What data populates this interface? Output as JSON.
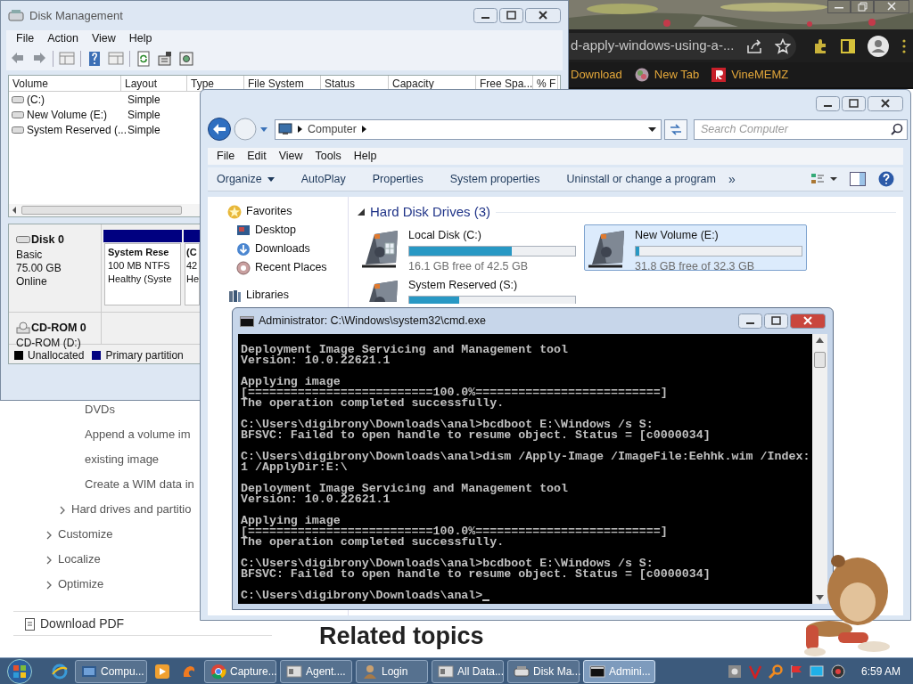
{
  "browser": {
    "url": "d-apply-windows-using-a-...",
    "bookmarks": [
      {
        "label": "Download",
        "kind": "none"
      },
      {
        "label": "New Tab",
        "kind": "globe"
      },
      {
        "label": "VineMEMZ",
        "kind": "letter"
      }
    ],
    "page": {
      "nav": [
        {
          "children": [
            {
              "children": [
                {
                  "lines": [
                    "DVDs"
                  ]
                },
                {
                  "lines": [
                    "Append a volume im",
                    "existing image"
                  ]
                },
                {
                  "lines": [
                    "Create a WIM data in"
                  ]
                }
              ]
            },
            {
              "lines": [
                "Hard drives and partitio"
              ],
              "expanded": false
            }
          ]
        },
        {
          "lines": [
            "Customize"
          ],
          "expanded": false
        },
        {
          "lines": [
            "Localize"
          ],
          "expanded": false
        },
        {
          "lines": [
            "Optimize"
          ],
          "expanded": false
        }
      ],
      "download": "Download PDF",
      "heading": "Related topics"
    }
  },
  "disk_management": {
    "title": "Disk Management",
    "menu": [
      "File",
      "Action",
      "View",
      "Help"
    ],
    "columns": [
      "Volume",
      "Layout",
      "Type",
      "File System",
      "Status",
      "Capacity",
      "Free Spa...",
      "% F"
    ],
    "volumes": [
      {
        "name": "(C:)",
        "layout": "Simple"
      },
      {
        "name": "New Volume (E:)",
        "layout": "Simple"
      },
      {
        "name": "System Reserved (...",
        "layout": "Simple"
      }
    ],
    "disks": [
      {
        "kind": "disk",
        "name": "Disk 0",
        "details": [
          "Basic",
          "75.00 GB",
          "Online"
        ],
        "partitions": [
          {
            "lines": [
              "System Rese",
              "100 MB NTFS",
              "Healthy (Syste"
            ]
          },
          {
            "lines": [
              "(C",
              "42",
              "He"
            ]
          }
        ]
      },
      {
        "kind": "cdrom",
        "name": "CD-ROM 0",
        "details": [
          "CD-ROM (D:)"
        ]
      }
    ],
    "legend": [
      {
        "label": "Unallocated",
        "color": "#000000"
      },
      {
        "label": "Primary partition",
        "color": "#000080"
      }
    ]
  },
  "explorer": {
    "address": [
      "Computer"
    ],
    "search": {
      "placeholder": "Search Computer"
    },
    "menu": [
      "File",
      "Edit",
      "View",
      "Tools",
      "Help"
    ],
    "commands": [
      {
        "label": "Organize",
        "dropdown": true
      },
      {
        "label": "AutoPlay",
        "dropdown": false
      },
      {
        "label": "Properties",
        "dropdown": false
      },
      {
        "label": "System properties",
        "dropdown": false
      },
      {
        "label": "Uninstall or change a program",
        "dropdown": false
      }
    ],
    "more": "»",
    "nav": [
      {
        "label": "Favorites",
        "kind": "star",
        "children": [
          {
            "label": "Desktop",
            "kind": "desktop"
          },
          {
            "label": "Downloads",
            "kind": "download"
          },
          {
            "label": "Recent Places",
            "kind": "recent"
          }
        ]
      },
      {
        "label": "Libraries",
        "kind": "library"
      }
    ],
    "group": {
      "title": "Hard Disk Drives (3)",
      "expanded": true
    },
    "drives": [
      {
        "name": "Local Disk (C:)",
        "level": 0.62,
        "free": "16.1 GB free of 42.5 GB",
        "selected": false,
        "windows": true
      },
      {
        "name": "New Volume (E:)",
        "level": 0.02,
        "free": "31.8 GB free of 32.3 GB",
        "selected": true,
        "windows": false
      },
      {
        "name": "System Reserved (S:)",
        "level": 0.3,
        "selected": false,
        "windows": false
      }
    ]
  },
  "cmd": {
    "title": "Administrator: C:\\Windows\\system32\\cmd.exe",
    "blocks": [
      [
        "Deployment Image Servicing and Management tool",
        "Version: 10.0.22621.1"
      ],
      [
        "Applying image",
        "[==========================100.0%==========================]",
        "The operation completed successfully."
      ],
      [
        "C:\\Users\\digibrony\\Downloads\\anal>bcdboot E:\\Windows /s S:",
        "BFSVC: Failed to open handle to resume object. Status = [c0000034]"
      ],
      [
        "C:\\Users\\digibrony\\Downloads\\anal>dism /Apply-Image /ImageFile:Eehhk.wim /Index:",
        "1 /ApplyDir:E:\\"
      ],
      [
        "Deployment Image Servicing and Management tool",
        "Version: 10.0.22621.1"
      ],
      [
        "Applying image",
        "[==========================100.0%==========================]",
        "The operation completed successfully."
      ],
      [
        "C:\\Users\\digibrony\\Downloads\\anal>bcdboot E:\\Windows /s S:",
        "BFSVC: Failed to open handle to resume object. Status = [c0000034]"
      ],
      [
        "C:\\Users\\digibrony\\Downloads\\anal>"
      ]
    ]
  },
  "taskbar": {
    "items": [
      {
        "kind": "ie"
      },
      {
        "kind": "folder",
        "label": "Compu...",
        "selected": false
      },
      {
        "kind": "media"
      },
      {
        "kind": "uc"
      },
      {
        "kind": "chrome",
        "label": "Capture...",
        "selected": false
      },
      {
        "kind": "window",
        "label": "Agent....",
        "selected": false
      },
      {
        "kind": "person",
        "label": "Login",
        "selected": false
      },
      {
        "kind": "window",
        "label": "All Data...",
        "selected": false
      },
      {
        "kind": "disk",
        "label": "Disk Ma...",
        "selected": false
      },
      {
        "kind": "console",
        "label": "Admini...",
        "selected": true
      }
    ],
    "clock": "6:59 AM"
  }
}
